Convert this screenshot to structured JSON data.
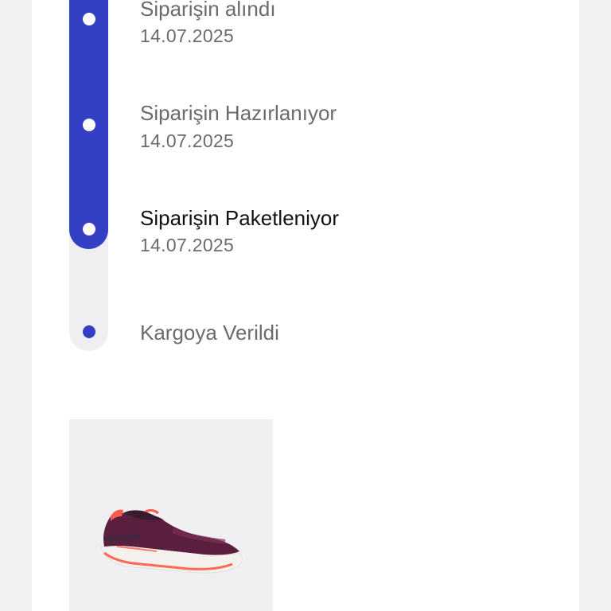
{
  "tracker": {
    "steps": [
      {
        "title": "Siparişin alındı",
        "date": "14.07.2025",
        "status": "done"
      },
      {
        "title": "Siparişin Hazırlanıyor",
        "date": "14.07.2025",
        "status": "done"
      },
      {
        "title": "Siparişin Paketleniyor",
        "date": "14.07.2025",
        "status": "current"
      },
      {
        "title": "Kargoya Verildi",
        "date": "",
        "status": "pending"
      }
    ],
    "progress_fraction": 0.75
  },
  "product": {
    "image_icon": "running-shoe-image",
    "colors": {
      "upper": "#5a1f3f",
      "accent": "#ff5a4e",
      "sole": "#f4f1ef"
    }
  },
  "colors": {
    "accent": "#3340c4",
    "track": "#efeff1",
    "background": "#f2f2f3"
  }
}
